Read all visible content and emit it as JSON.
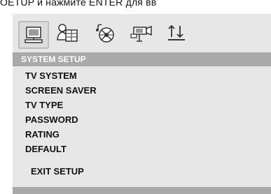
{
  "caption": "OETUP и нажмите ENTER для вв",
  "icons": [
    "monitor-icon",
    "language-icon",
    "audio-disc-icon",
    "video-camera-icon",
    "speaker-adjust-icon"
  ],
  "header": {
    "title": "SYSTEM SETUP"
  },
  "menu": {
    "items": [
      "TV SYSTEM",
      "SCREEN SAVER",
      "TV TYPE",
      "PASSWORD",
      "RATING",
      "DEFAULT"
    ]
  },
  "exit_label": "EXIT SETUP",
  "colors": {
    "panel": "#e7e7e7",
    "bar": "#a9a9a9",
    "text": "#111111"
  }
}
